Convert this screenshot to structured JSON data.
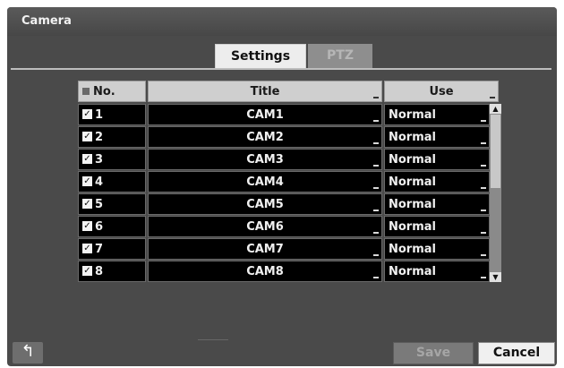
{
  "window": {
    "title": "Camera"
  },
  "tabs": [
    {
      "label": "Settings",
      "active": true
    },
    {
      "label": "PTZ",
      "active": false
    }
  ],
  "table": {
    "headers": {
      "no": "No.",
      "title": "Title",
      "use": "Use"
    },
    "rows": [
      {
        "no": "1",
        "checked": true,
        "title": "CAM1",
        "use": "Normal"
      },
      {
        "no": "2",
        "checked": true,
        "title": "CAM2",
        "use": "Normal"
      },
      {
        "no": "3",
        "checked": true,
        "title": "CAM3",
        "use": "Normal"
      },
      {
        "no": "4",
        "checked": true,
        "title": "CAM4",
        "use": "Normal"
      },
      {
        "no": "5",
        "checked": true,
        "title": "CAM5",
        "use": "Normal"
      },
      {
        "no": "6",
        "checked": true,
        "title": "CAM6",
        "use": "Normal"
      },
      {
        "no": "7",
        "checked": true,
        "title": "CAM7",
        "use": "Normal"
      },
      {
        "no": "8",
        "checked": true,
        "title": "CAM8",
        "use": "Normal"
      }
    ]
  },
  "footer": {
    "save_label": "Save",
    "cancel_label": "Cancel",
    "back_icon": "return-arrow-icon"
  },
  "colors": {
    "window_bg": "#4a4a4a",
    "cell_bg": "#000000",
    "header_bg": "#cfcfcf"
  }
}
